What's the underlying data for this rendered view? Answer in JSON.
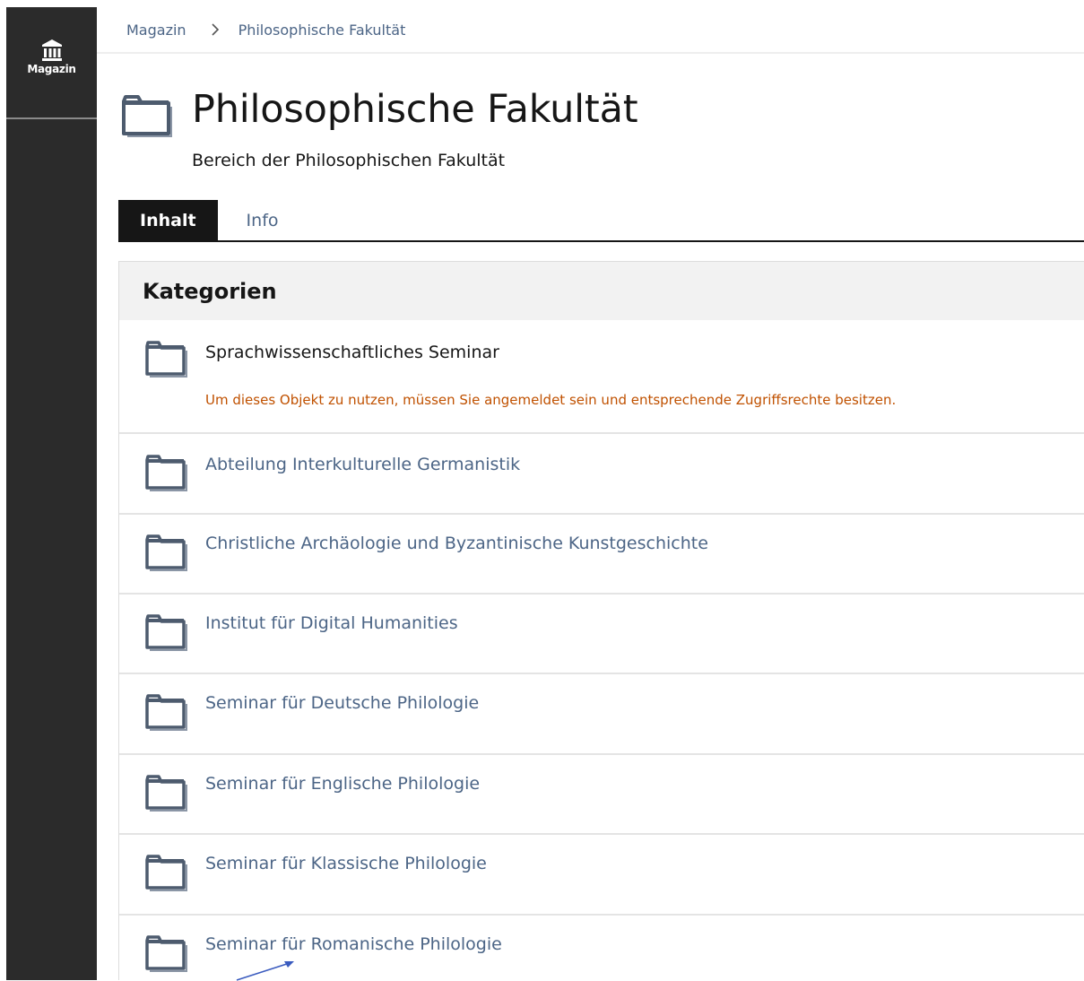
{
  "mainbar": {
    "label": "Magazin",
    "icon": "museum-icon"
  },
  "breadcrumb": {
    "items": [
      "Magazin",
      "Philosophische Fakultät"
    ]
  },
  "header": {
    "title": "Philosophische Fakultät",
    "description": "Bereich der Philosophischen Fakultät"
  },
  "tabs": [
    {
      "label": "Inhalt",
      "active": true
    },
    {
      "label": "Info",
      "active": false
    }
  ],
  "panel": {
    "heading": "Kategorien",
    "items": [
      {
        "title": "Sprachwissenschaftliches Seminar",
        "alert": "Um dieses Objekt zu nutzen, müssen Sie angemeldet sein und entsprechende Zugriffsrechte besitzen."
      },
      {
        "title": "Abteilung Interkulturelle Germanistik"
      },
      {
        "title": "Christliche Archäologie und Byzantinische Kunstgeschichte"
      },
      {
        "title": "Institut für Digital Humanities"
      },
      {
        "title": "Seminar für Deutsche Philologie"
      },
      {
        "title": "Seminar für Englische Philologie"
      },
      {
        "title": "Seminar für Klassische Philologie"
      },
      {
        "title": "Seminar für Romanische Philologie"
      }
    ]
  },
  "colors": {
    "link": "#4c6586",
    "alert": "#c05100",
    "mainbar": "#2b2b2b",
    "annotation_arrow": "#3a5bbf"
  }
}
